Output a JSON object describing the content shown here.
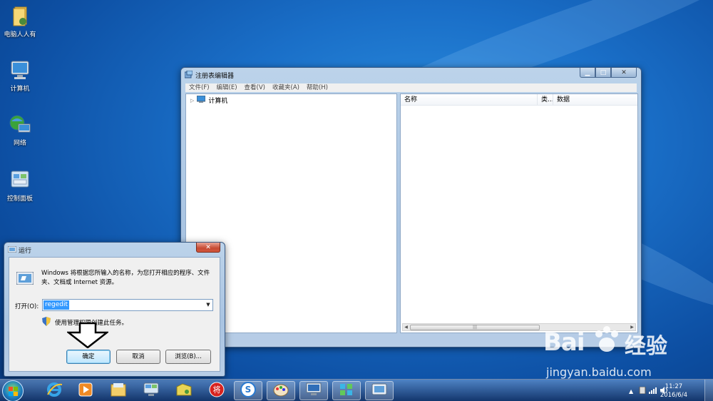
{
  "desktop": {
    "icons": [
      {
        "label": "电脑人人有",
        "icon": "folder-user-icon"
      },
      {
        "label": "计算机",
        "icon": "computer-icon"
      },
      {
        "label": "网络",
        "icon": "network-icon"
      },
      {
        "label": "控制面板",
        "icon": "control-panel-icon"
      }
    ]
  },
  "regedit": {
    "title": "注册表编辑器",
    "menu": [
      "文件(F)",
      "编辑(E)",
      "查看(V)",
      "收藏夹(A)",
      "帮助(H)"
    ],
    "tree_root": "计算机",
    "columns": [
      "名称",
      "类...",
      "数据"
    ]
  },
  "run_dialog": {
    "title": "运行",
    "description": "Windows 将根据您所输入的名称，为您打开相应的程序、文件夹、文档或 Internet 资源。",
    "open_label": "打开(O):",
    "input_value": "regedit",
    "admin_text": "使用管理权限创建此任务。",
    "ok_label": "确定",
    "cancel_label": "取消",
    "browse_label": "浏览(B)..."
  },
  "taskbar": {
    "apps": [
      "ie-icon",
      "media-player-icon",
      "explorer-icon",
      "remote-desktop-icon",
      "folder-share-icon",
      "chess-icon",
      "sogou-icon",
      "paint-icon",
      "monitor-icon",
      "network-share-icon",
      "run-icon"
    ],
    "time": "11:27",
    "date": "2016/6/4"
  },
  "watermark": {
    "brand": "Bai",
    "brand_cn": "经验",
    "url": "jingyan.baidu.com"
  }
}
